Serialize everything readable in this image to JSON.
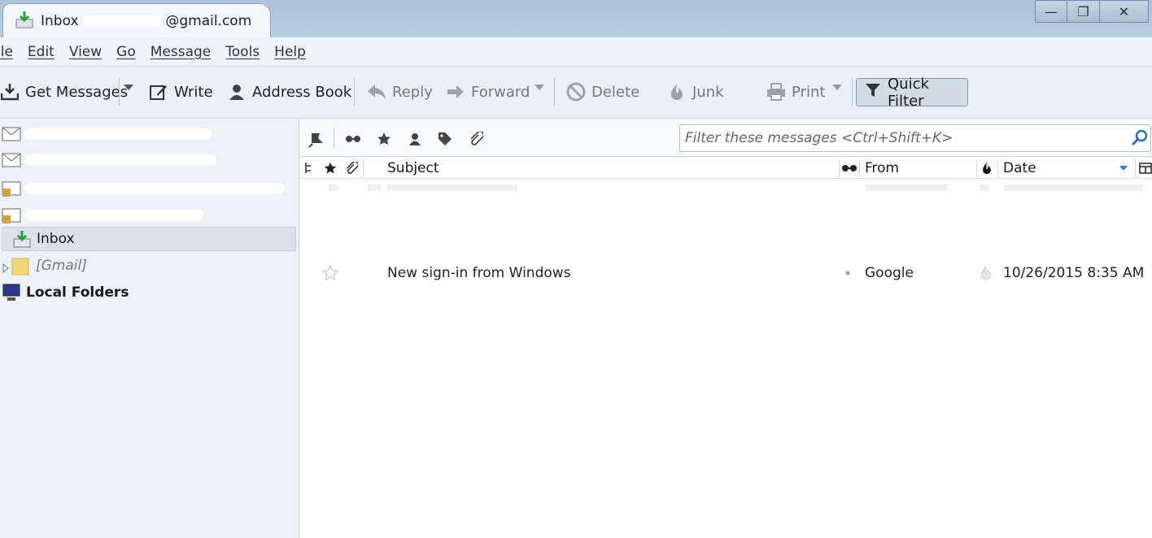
{
  "window": {
    "tab_title_prefix": "Inbox",
    "tab_title_suffix": "@gmail.com",
    "minimize_glyph": "—",
    "maximize_glyph": "❐",
    "close_glyph": "✕"
  },
  "menubar": {
    "items": [
      {
        "label": "ile"
      },
      {
        "label": "Edit"
      },
      {
        "label": "View"
      },
      {
        "label": "Go"
      },
      {
        "label": "Message"
      },
      {
        "label": "Tools"
      },
      {
        "label": "Help"
      }
    ]
  },
  "toolbar": {
    "get_messages": "Get Messages",
    "write": "Write",
    "address_book": "Address Book",
    "reply": "Reply",
    "forward": "Forward",
    "delete": "Delete",
    "junk": "Junk",
    "print": "Print",
    "quick_filter": "Quick Filter"
  },
  "folders": {
    "inbox": "Inbox",
    "gmail": "[Gmail]",
    "local_folders": "Local Folders"
  },
  "filterbar": {
    "placeholder": "Filter these messages <Ctrl+Shift+K>"
  },
  "columns": {
    "subject": "Subject",
    "from": "From",
    "date": "Date"
  },
  "messages": [
    {
      "subject": "New sign-in from Windows",
      "from": "Google",
      "date": "10/26/2015 8:35 AM",
      "starred": false
    }
  ],
  "colors": {
    "accent": "#3a78c2",
    "titlebar": "#b3c8dd",
    "toolbar": "#e9f0f7",
    "folderpane": "#edf2f7"
  }
}
